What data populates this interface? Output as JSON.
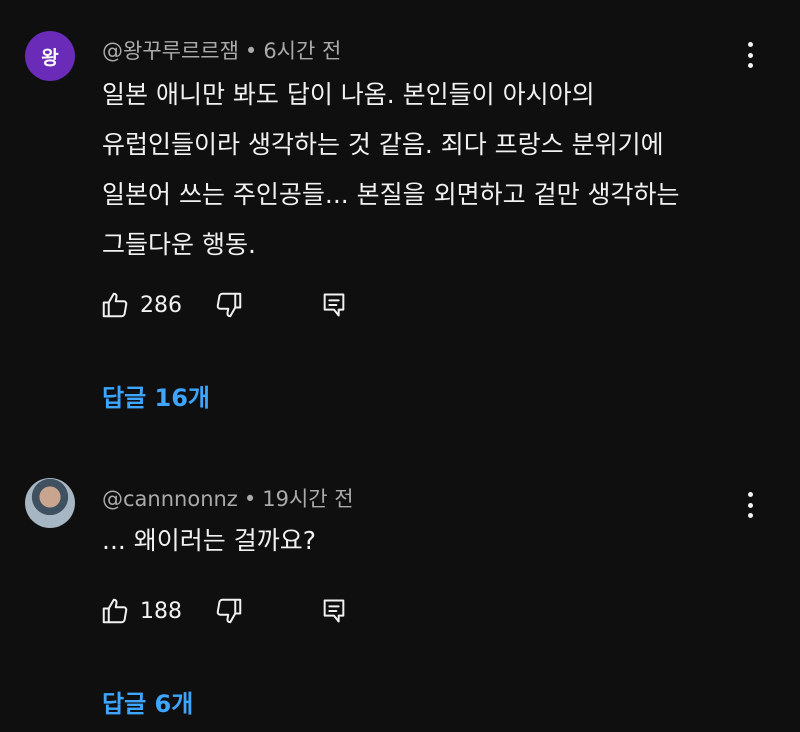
{
  "comments": [
    {
      "avatar_letter": "왕",
      "author": "@왕꾸루르르잼",
      "time": "6시간 전",
      "lines": [
        "일본 애니만 봐도 답이 나옴. 본인들이 아시아의",
        "유럽인들이라 생각하는 것 같음. 죄다 프랑스 분위기에",
        "일본어 쓰는 주인공들... 본질을 외면하고 겉만 생각하는",
        "그들다운 행동."
      ],
      "likes": "286",
      "replies_label": "답글 16개"
    },
    {
      "author": "@cannnonnz",
      "time": "19시간 전",
      "lines": [
        "... 왜이러는 걸까요?"
      ],
      "likes": "188",
      "replies_label": "답글 6개"
    }
  ],
  "separator": "•",
  "colors": {
    "background": "#0f0f0f",
    "text": "#f1f1f1",
    "meta": "#aaaaaa",
    "link": "#3ea6ff",
    "avatar_purple": "#6a2bb8"
  },
  "icons": [
    "thumbs-up-icon",
    "thumbs-down-icon",
    "reply-icon",
    "more-vert-icon"
  ]
}
